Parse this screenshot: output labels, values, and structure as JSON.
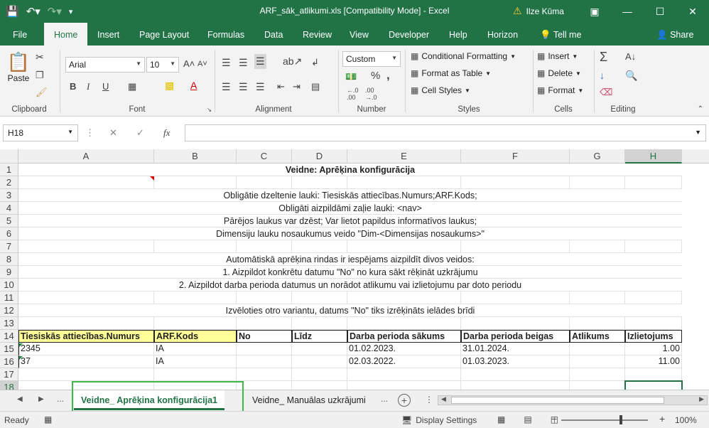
{
  "window": {
    "title": "ARF_sāk_atlikumi.xls  [Compatibility Mode]  -  Excel",
    "user": "Ilze Kūma"
  },
  "ribbon_tabs": [
    "File",
    "Home",
    "Insert",
    "Page Layout",
    "Formulas",
    "Data",
    "Review",
    "View",
    "Developer",
    "Help",
    "Horizon",
    "Tell me",
    "Share"
  ],
  "ribbon": {
    "clipboard": {
      "paste": "Paste",
      "label": "Clipboard"
    },
    "font": {
      "name": "Arial",
      "size": "10",
      "label": "Font",
      "bold": "B",
      "italic": "I",
      "underline": "U"
    },
    "alignment": {
      "label": "Alignment"
    },
    "number": {
      "format": "Custom",
      "percent": "%",
      "comma": ",",
      "label": "Number"
    },
    "styles": {
      "conditional": "Conditional Formatting",
      "table": "Format as Table",
      "cell": "Cell Styles",
      "label": "Styles"
    },
    "cells": {
      "insert": "Insert",
      "delete": "Delete",
      "format": "Format",
      "label": "Cells"
    },
    "editing": {
      "label": "Editing"
    }
  },
  "formula_bar": {
    "name_box": "H18",
    "fx": "fx",
    "formula": ""
  },
  "columns": [
    "A",
    "B",
    "C",
    "D",
    "E",
    "F",
    "G",
    "H"
  ],
  "rows": [
    "1",
    "2",
    "3",
    "4",
    "5",
    "6",
    "7",
    "8",
    "9",
    "10",
    "11",
    "12",
    "13",
    "14",
    "15",
    "16",
    "17",
    "18"
  ],
  "sheet": {
    "title": "Veidne: Aprēķina konfigurācija",
    "lines": {
      "r3": "Obligātie dzeltenie lauki: Tiesiskās attiecības.Numurs;ARF.Kods;",
      "r4": "Obligāti aizpildāmi zaļie lauki: <nav>",
      "r5": "Pārējos laukus var dzēst; Var lietot papildus informatīvos laukus;",
      "r6": "Dimensiju lauku nosaukumus veido \"Dim-<Dimensijas nosaukums>\"",
      "r8": "Automātiskā aprēķina rindas ir iespējams aizpildīt divos veidos:",
      "r9": "1. Aizpildot konkrētu datumu \"No\" no kura sākt rēķināt uzkrājumu",
      "r10": "2. Aizpildot darba perioda datumus un norādot atlikumu vai izlietojumu par doto periodu",
      "r12": "Izvēloties otro variantu, datums \"No\" tiks izrēķināts ielādes brīdi"
    },
    "headers": [
      "Tiesiskās attiecības.Numurs",
      "ARF.Kods",
      "No",
      "Līdz",
      "Darba perioda sākums",
      "Darba perioda beigas",
      "Atlikums",
      "Izlietojums"
    ],
    "data": [
      [
        "2345",
        "IA",
        "",
        "",
        "01.02.2023.",
        "31.01.2024.",
        "",
        "1.00"
      ],
      [
        "37",
        "IA",
        "",
        "",
        "02.03.2022.",
        "01.03.2023.",
        "",
        "11.00"
      ]
    ]
  },
  "sheet_tabs": {
    "nav_more": "...",
    "active": "Veidne_ Aprēķina konfigurācija1",
    "other": "Veidne_ Manuālas uzkrājumi",
    "more": "..."
  },
  "status": {
    "ready": "Ready",
    "display_settings": "Display Settings",
    "zoom": "100%"
  },
  "colors": {
    "excel_green": "#217346",
    "header_yellow": "#ffff99",
    "highlight_frame": "#3cb94a"
  }
}
